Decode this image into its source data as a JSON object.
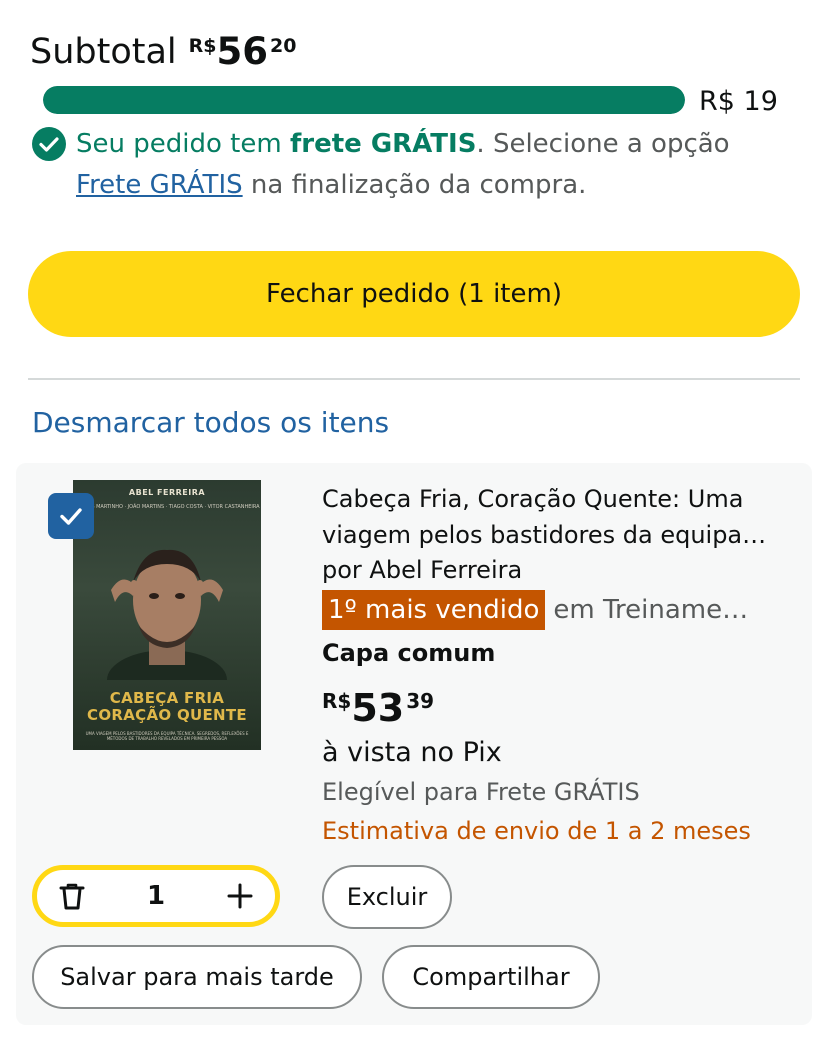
{
  "subtotal": {
    "label": "Subtotal",
    "currency": "R$",
    "whole": "56",
    "fraction": "20"
  },
  "free_shipping_progress": {
    "fraction": 1.0,
    "threshold_label": "R$ 19",
    "bar_color": "#067d62"
  },
  "free_shipping_message": {
    "part1": "Seu pedido tem ",
    "bold": "frete GRÁTIS",
    "part2": ". Selecione a opção ",
    "link": "Frete GRÁTIS",
    "part3": " na finalização da compra."
  },
  "checkout": {
    "label": "Fechar pedido (1 item)"
  },
  "deselect_all": "Desmarcar todos os itens",
  "item": {
    "selected": true,
    "cover": {
      "author_text": "ABEL FERREIRA",
      "names_text": "CARLOS MARTINHO · JOÃO MARTINS · TIAGO COSTA · VITOR CASTANHEIRA",
      "title_line1": "CABEÇA FRIA",
      "title_line2": "CORAÇÃO QUENTE",
      "subtitle": "UMA VIAGEM PELOS BASTIDORES DA EQUIPA TÉCNICA. SEGREDOS, REFLEXÕES E MÉTODOS DE TRABALHO REVELADOS EM PRIMEIRA PESSOA"
    },
    "title": "Cabeça Fria, Coração Quente: Uma viagem pelos bastidores da equipa…",
    "author": "por Abel Ferreira",
    "badge": "1º mais vendido",
    "badge_category": "em Treiname…",
    "format": "Capa comum",
    "price_currency": "R$",
    "price_whole": "53",
    "price_fraction": "39",
    "payment_note": "à vista no Pix",
    "eligibility": "Elegível para Frete GRÁTIS",
    "delivery_estimate": "Estimativa de envio de 1 a 2 meses",
    "quantity": "1"
  },
  "actions": {
    "delete": "Excluir",
    "save_for_later": "Salvar para mais tarde",
    "share": "Compartilhar"
  },
  "colors": {
    "accent_yellow": "#ffd814",
    "link_blue": "#2162a1",
    "success_green": "#067d62",
    "badge_orange": "#c45500"
  },
  "icons": {
    "free_shipping": "check-circle-icon",
    "quantity_delete": "trash-icon",
    "quantity_increase": "plus-icon",
    "item_checkbox": "checkmark-icon"
  }
}
